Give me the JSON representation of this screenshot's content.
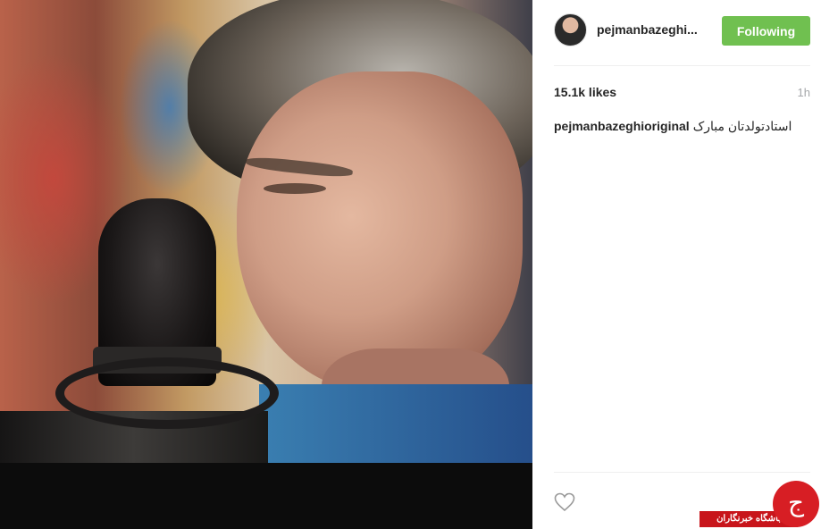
{
  "post": {
    "username": "pejmanbazeghi...",
    "follow_label": "Following",
    "likes": "15.1k likes",
    "time": "1h",
    "caption_user": "pejmanbazeghioriginal",
    "caption_text": "استادتولدتان مبارک"
  },
  "watermark": {
    "logo_glyph": "ج",
    "text": "باشگاه خبرنگاران"
  },
  "colors": {
    "follow_button": "#70c050",
    "watermark_red": "#d71e24"
  }
}
